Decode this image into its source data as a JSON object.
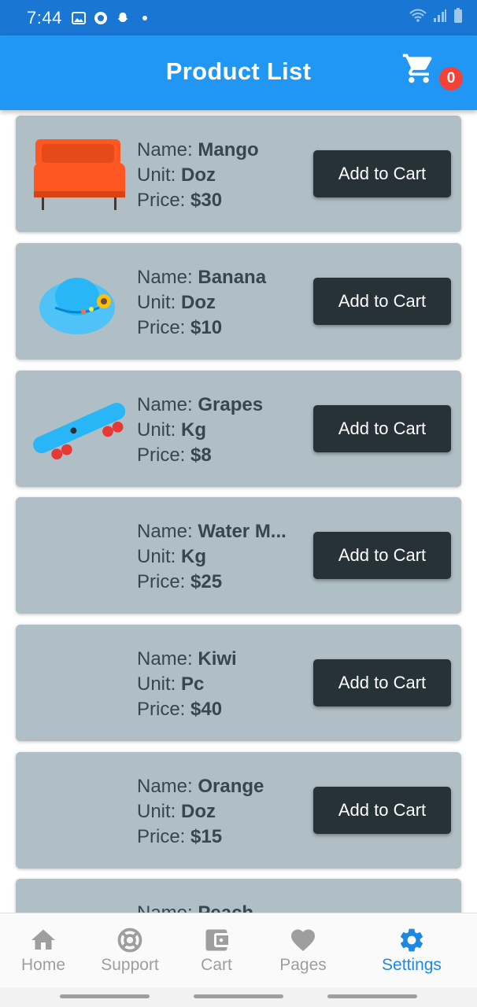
{
  "status_bar": {
    "time": "7:44",
    "left_icons": [
      "image-icon",
      "badge-icon",
      "snapchat-icon",
      "dot-icon"
    ],
    "right_icons": [
      "wifi-icon",
      "signal-icon",
      "battery-icon"
    ]
  },
  "app_bar": {
    "title": "Product List",
    "cart_count": "0",
    "cart_icon": "cart-icon"
  },
  "labels": {
    "name": "Name: ",
    "unit": "Unit: ",
    "price": "Price: ",
    "add_to_cart": "Add to Cart"
  },
  "products": [
    {
      "name": "Mango",
      "unit": "Doz",
      "price": "$30",
      "image": "orange-sofa-image"
    },
    {
      "name": "Banana",
      "unit": "Doz",
      "price": "$10",
      "image": "blue-hat-image"
    },
    {
      "name": "Grapes",
      "unit": "Kg",
      "price": "$8",
      "image": "skateboard-image"
    },
    {
      "name": "Water M...",
      "unit": "Kg",
      "price": "$25",
      "image": ""
    },
    {
      "name": "Kiwi",
      "unit": "Pc",
      "price": "$40",
      "image": ""
    },
    {
      "name": "Orange",
      "unit": "Doz",
      "price": "$15",
      "image": ""
    },
    {
      "name": "Peach",
      "unit": "",
      "price": "",
      "image": ""
    }
  ],
  "bottom_nav": [
    {
      "label": "Home",
      "icon": "home-icon",
      "active": false
    },
    {
      "label": "Support",
      "icon": "support-icon",
      "active": false
    },
    {
      "label": "Cart",
      "icon": "wallet-icon",
      "active": false
    },
    {
      "label": "Pages",
      "icon": "heart-icon",
      "active": false
    },
    {
      "label": "Settings",
      "icon": "gear-icon",
      "active": true
    }
  ],
  "colors": {
    "status_bar": "#1976d2",
    "app_bar": "#2196f3",
    "card": "#b0bec5",
    "button": "#263238",
    "badge": "#f44336",
    "nav_active": "#1e88e5",
    "nav_inactive": "#9e9e9e"
  }
}
